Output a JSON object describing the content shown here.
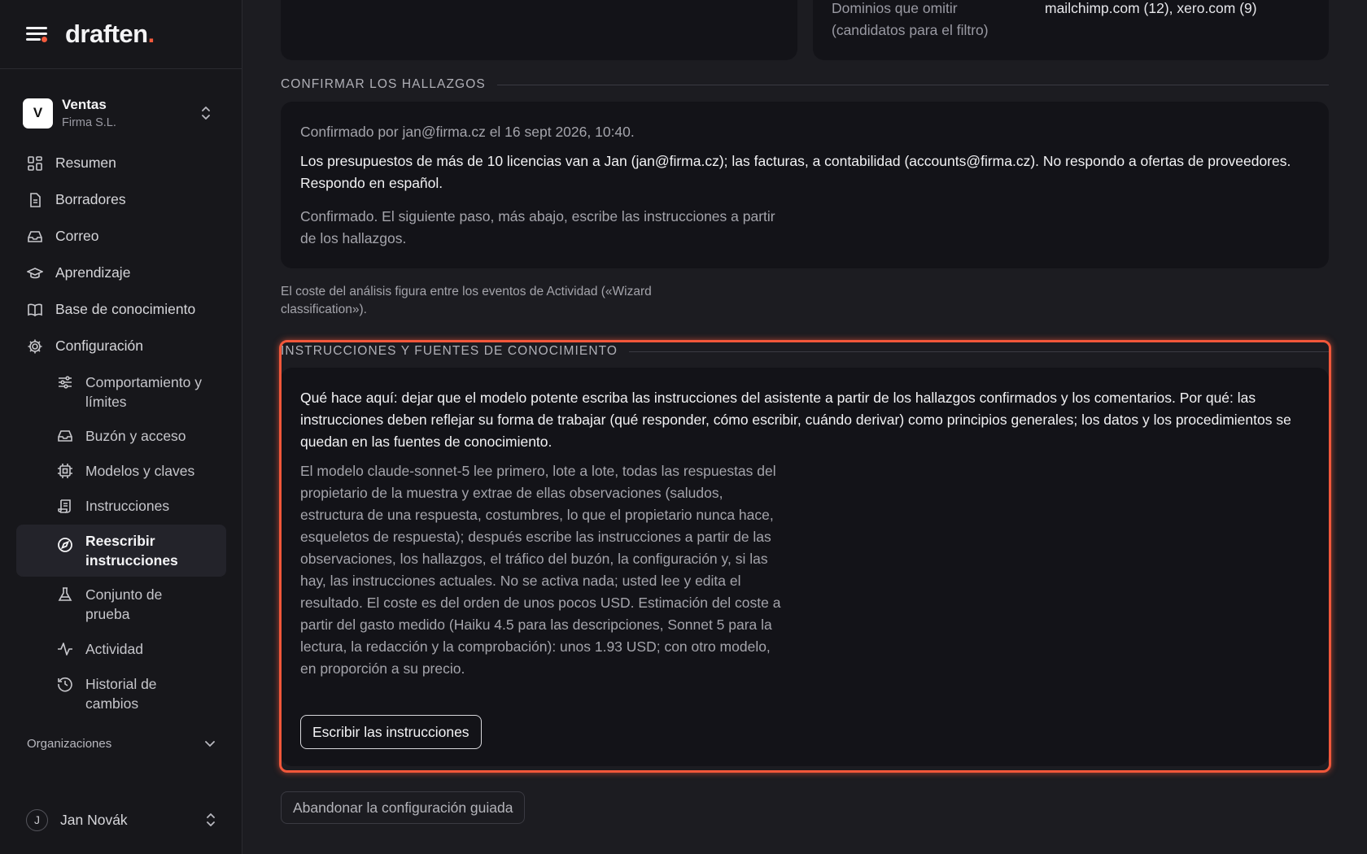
{
  "app": {
    "logo_text": "draften",
    "logo_dot": "."
  },
  "org": {
    "avatar": "V",
    "name": "Ventas",
    "subtitle": "Firma S.L."
  },
  "nav": [
    {
      "label": "Resumen",
      "icon": "grid-icon"
    },
    {
      "label": "Borradores",
      "icon": "document-icon"
    },
    {
      "label": "Correo",
      "icon": "inbox-icon"
    },
    {
      "label": "Aprendizaje",
      "icon": "graduation-cap-icon"
    },
    {
      "label": "Base de conocimiento",
      "icon": "book-icon"
    },
    {
      "label": "Configuración",
      "icon": "gear-icon"
    }
  ],
  "subnav": [
    {
      "label": "Comportamiento y límites",
      "icon": "sliders-icon"
    },
    {
      "label": "Buzón y acceso",
      "icon": "inbox-icon"
    },
    {
      "label": "Modelos y claves",
      "icon": "chip-icon"
    },
    {
      "label": "Instrucciones",
      "icon": "scroll-icon"
    },
    {
      "label": "Reescribir instrucciones",
      "icon": "compass-icon",
      "active": true
    },
    {
      "label": "Conjunto de prueba",
      "icon": "flask-icon"
    },
    {
      "label": "Actividad",
      "icon": "activity-icon"
    },
    {
      "label": "Historial de cambios",
      "icon": "history-icon"
    }
  ],
  "orgs_section": {
    "label": "Organizaciones"
  },
  "user": {
    "avatar": "J",
    "name": "Jan Novák"
  },
  "top_card": {
    "key": "Dominios que omitir (candidatos para el filtro)",
    "value": "mailchimp.com (12), xero.com (9)"
  },
  "confirm": {
    "title": "CONFIRMAR LOS HALLAZGOS",
    "confirmed_by": "Confirmado por jan@firma.cz el 16 sept 2026, 10:40.",
    "findings": "Los presupuestos de más de 10 licencias van a Jan (jan@firma.cz); las facturas, a contabilidad (accounts@firma.cz). No respondo a ofertas de proveedores. Respondo en español.",
    "next_step": "Confirmado. El siguiente paso, más abajo, escribe las instrucciones a partir de los hallazgos."
  },
  "cost_note": "El coste del análisis figura entre los eventos de Actividad («Wizard classification»).",
  "instructions": {
    "title": "INSTRUCCIONES Y FUENTES DE CONOCIMIENTO",
    "what": "Qué hace aquí: dejar que el modelo potente escriba las instrucciones del asistente a partir de los hallazgos confirmados y los comentarios. Por qué: las instrucciones deben reflejar su forma de trabajar (qué responder, cómo escribir, cuándo derivar) como principios generales; los datos y los procedimientos se quedan en las fuentes de conocimiento.",
    "detail": "El modelo claude-sonnet-5 lee primero, lote a lote, todas las respuestas del propietario de la muestra y extrae de ellas observaciones (saludos, estructura de una respuesta, costumbres, lo que el propietario nunca hace, esqueletos de respuesta); después escribe las instrucciones a partir de las observaciones, los hallazgos, el tráfico del buzón, la configuración y, si las hay, las instrucciones actuales. No se activa nada; usted lee y edita el resultado. El coste es del orden de unos pocos USD. Estimación del coste a partir del gasto medido (Haiku 4.5 para las descripciones, Sonnet 5 para la lectura, la redacción y la comprobación): unos 1.93 USD; con otro modelo, en proporción a su precio.",
    "button": "Escribir las instrucciones"
  },
  "abandon_button": "Abandonar la configuración guiada",
  "colors": {
    "accent": "#f2573a",
    "background": "#1c1c21",
    "sidebar": "#17171b",
    "card": "#131318"
  }
}
